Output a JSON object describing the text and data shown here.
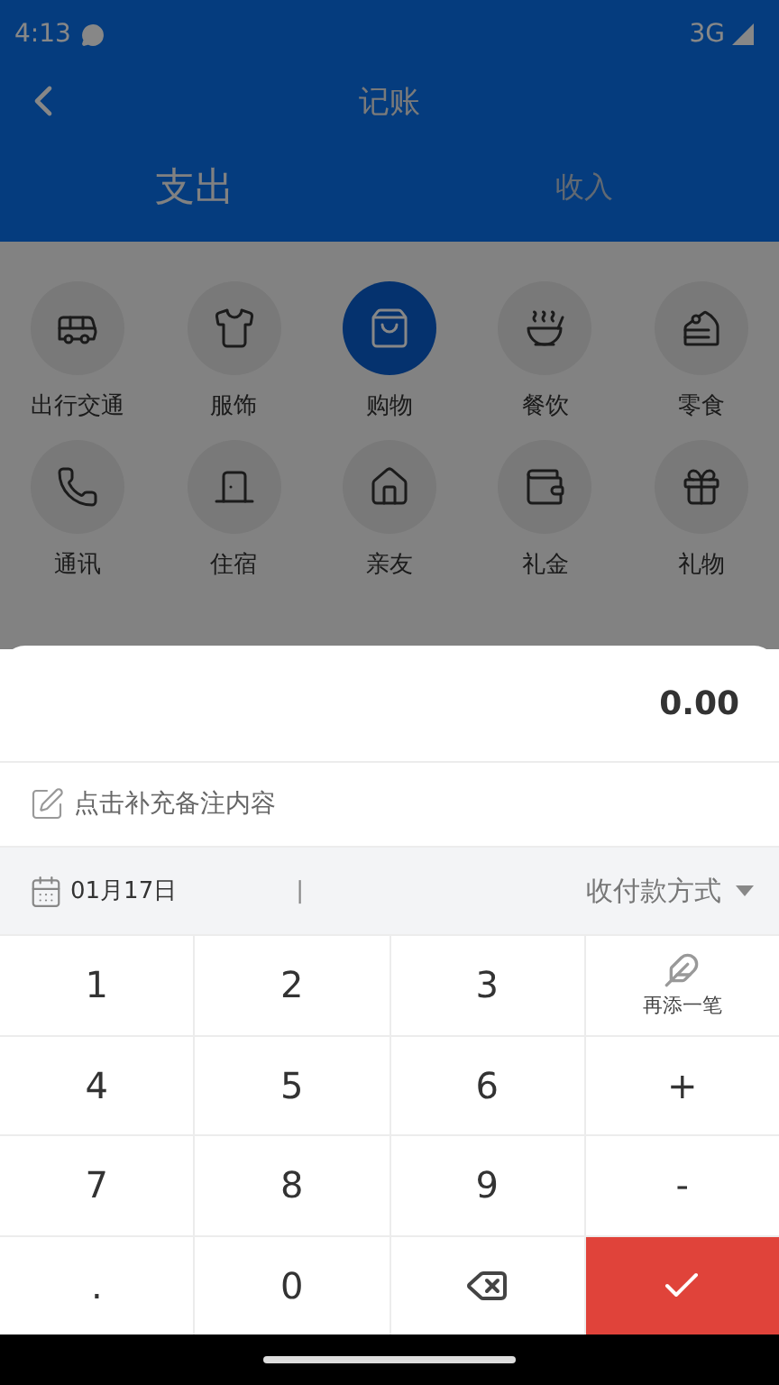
{
  "status_bar": {
    "time": "4:13",
    "network": "3G"
  },
  "header": {
    "title": "记账"
  },
  "tabs": [
    {
      "label": "支出",
      "selected": true
    },
    {
      "label": "收入",
      "selected": false
    }
  ],
  "categories": [
    {
      "label": "出行交通",
      "selected": false
    },
    {
      "label": "服饰",
      "selected": false
    },
    {
      "label": "购物",
      "selected": true
    },
    {
      "label": "餐饮",
      "selected": false
    },
    {
      "label": "零食",
      "selected": false
    },
    {
      "label": "通讯",
      "selected": false
    },
    {
      "label": "住宿",
      "selected": false
    },
    {
      "label": "亲友",
      "selected": false
    },
    {
      "label": "礼金",
      "selected": false
    },
    {
      "label": "礼物",
      "selected": false
    }
  ],
  "entry": {
    "amount": "0.00",
    "note_placeholder": "点击补充备注内容",
    "date": "01月17日",
    "separator": "|",
    "payment_method": "收付款方式"
  },
  "keypad": [
    {
      "kind": "key",
      "label": "1"
    },
    {
      "kind": "key",
      "label": "2"
    },
    {
      "kind": "key",
      "label": "3"
    },
    {
      "kind": "add_another",
      "label": "再添一笔"
    },
    {
      "kind": "key",
      "label": "4"
    },
    {
      "kind": "key",
      "label": "5"
    },
    {
      "kind": "key",
      "label": "6"
    },
    {
      "kind": "key",
      "label": "+"
    },
    {
      "kind": "key",
      "label": "7"
    },
    {
      "kind": "key",
      "label": "8"
    },
    {
      "kind": "key",
      "label": "9"
    },
    {
      "kind": "key",
      "label": "-"
    },
    {
      "kind": "key",
      "label": "."
    },
    {
      "kind": "key",
      "label": "0"
    },
    {
      "kind": "delete"
    },
    {
      "kind": "confirm"
    }
  ]
}
